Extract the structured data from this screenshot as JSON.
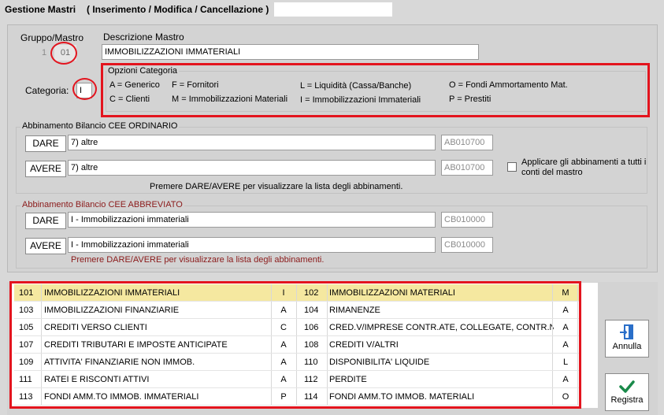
{
  "window": {
    "title": "Gestione Mastri",
    "subtitle": "( Inserimento / Modifica / Cancellazione )"
  },
  "header": {
    "gruppo_mastro_label": "Gruppo/Mastro",
    "gruppo_value": "1",
    "mastro_value": "01",
    "descrizione_label": "Descrizione Mastro",
    "descrizione_value": "IMMOBILIZZAZIONI IMMATERIALI",
    "categoria_label": "Categoria:",
    "categoria_value": "I"
  },
  "opzioni": {
    "title": "Opzioni Categoria",
    "items": [
      "A = Generico",
      "F = Fornitori",
      "L = Liquidità (Cassa/Banche)",
      "O = Fondi Ammortamento Mat.",
      "C = Clienti",
      "M = Immobilizzazioni Materiali",
      "I = Immobilizzazioni Immateriali",
      "P = Prestiti"
    ]
  },
  "cee_ordinario": {
    "title": "Abbinamento Bilancio CEE ORDINARIO",
    "dare_label": "DARE",
    "dare_desc": "7) altre",
    "dare_code": "AB010700",
    "avere_label": "AVERE",
    "avere_desc": "7) altre",
    "avere_code": "AB010700",
    "apply_label": "Applicare gli abbinamenti a tutti i conti del mastro",
    "hint": "Premere DARE/AVERE per visualizzare la lista degli abbinamenti."
  },
  "cee_abbreviato": {
    "title": "Abbinamento Bilancio CEE ABBREVIATO",
    "dare_label": "DARE",
    "dare_desc": "I - Immobilizzazioni immateriali",
    "dare_code": "CB010000",
    "avere_label": "AVERE",
    "avere_desc": "I - Immobilizzazioni immateriali",
    "avere_code": "CB010000",
    "hint": "Premere DARE/AVERE per visualizzare la lista degli abbinamenti."
  },
  "table": {
    "rows": [
      {
        "c1": "101",
        "d1": "IMMOBILIZZAZIONI IMMATERIALI",
        "k1": "I",
        "c2": "102",
        "d2": "IMMOBILIZZAZIONI MATERIALI",
        "k2": "M"
      },
      {
        "c1": "103",
        "d1": "IMMOBILIZZAZIONI FINANZIARIE",
        "k1": "A",
        "c2": "104",
        "d2": "RIMANENZE",
        "k2": "A"
      },
      {
        "c1": "105",
        "d1": "CREDITI VERSO CLIENTI",
        "k1": "C",
        "c2": "106",
        "d2": "CRED.V/IMPRESE CONTR.ATE, COLLEGATE, CONTR.NT",
        "k2": "A"
      },
      {
        "c1": "107",
        "d1": "CREDITI TRIBUTARI E IMPOSTE ANTICIPATE",
        "k1": "A",
        "c2": "108",
        "d2": "CREDITI V/ALTRI",
        "k2": "A"
      },
      {
        "c1": "109",
        "d1": "ATTIVITA' FINANZIARIE NON IMMOB.",
        "k1": "A",
        "c2": "110",
        "d2": "DISPONIBILITA' LIQUIDE",
        "k2": "L"
      },
      {
        "c1": "111",
        "d1": "RATEI E RISCONTI ATTIVI",
        "k1": "A",
        "c2": "112",
        "d2": "PERDITE",
        "k2": "A"
      },
      {
        "c1": "113",
        "d1": "FONDI AMM.TO IMMOB. IMMATERIALI",
        "k1": "P",
        "c2": "114",
        "d2": "FONDI AMM.TO IMMOB. MATERIALI",
        "k2": "O"
      }
    ]
  },
  "actions": {
    "annulla_label": "Annulla",
    "registra_label": "Registra"
  },
  "colors": {
    "annotation_red": "#e3141e",
    "selected_row": "#f5e8a0",
    "cee_abbreviato_title": "#8b1a1a",
    "hint_abbreviato": "#8b1a1a",
    "registra_check": "#1a8a4a",
    "annulla_icon": "#2a6fc9"
  }
}
